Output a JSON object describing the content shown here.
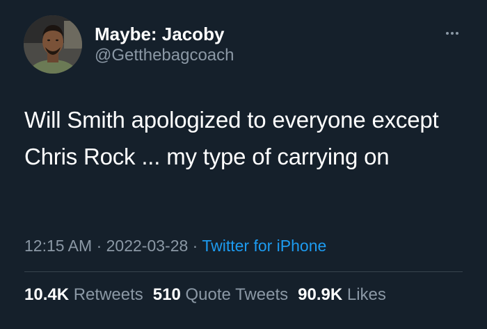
{
  "user": {
    "display_name": "Maybe: Jacoby",
    "handle": "@Getthebagcoach",
    "avatar_icon": "profile-photo"
  },
  "more_icon": "more-horizontal-icon",
  "tweet": {
    "text": "Will Smith apologized to everyone except Chris Rock ... my type of carrying on"
  },
  "meta": {
    "time": "12:15 AM",
    "separator1": " · ",
    "date": "2022-03-28",
    "separator2": " · ",
    "source": "Twitter for iPhone"
  },
  "stats": [
    {
      "count": "10.4K",
      "label": "Retweets"
    },
    {
      "count": "510",
      "label": "Quote Tweets"
    },
    {
      "count": "90.9K",
      "label": "Likes"
    }
  ],
  "colors": {
    "background": "#15202b",
    "secondary_text": "#8b98a5",
    "link": "#1d9bf0",
    "divider": "#38444d"
  }
}
